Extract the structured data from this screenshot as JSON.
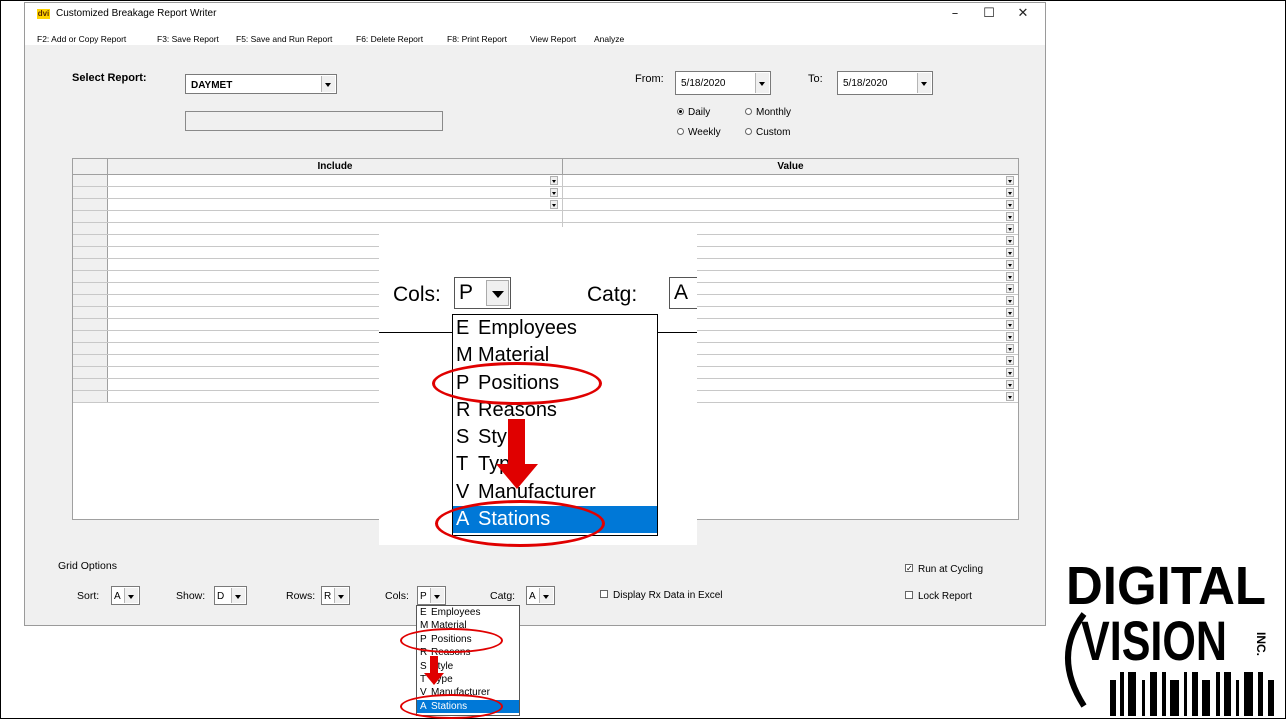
{
  "window": {
    "app_icon": "dvi",
    "title": "Customized Breakage Report Writer",
    "controls": [
      "–",
      "☐",
      "✕"
    ]
  },
  "menu": [
    "F2: Add or Copy Report",
    "F3: Save Report",
    "F5: Save and Run Report",
    "F6: Delete Report",
    "F8: Print Report",
    "View Report",
    "Analyze"
  ],
  "report": {
    "select_label": "Select Report:",
    "selected": "DAYMET",
    "description": ""
  },
  "dates": {
    "from_label": "From:",
    "from_value": "5/18/2020",
    "to_label": "To:",
    "to_value": "5/18/2020"
  },
  "period": {
    "options": [
      "Daily",
      "Monthly",
      "Weekly",
      "Custom"
    ],
    "selected": "Daily"
  },
  "grid": {
    "headers": [
      "Include",
      "Value"
    ],
    "row_count": 19
  },
  "grid_options": {
    "title": "Grid Options",
    "sort_label": "Sort:",
    "sort_value": "A",
    "show_label": "Show:",
    "show_value": "D",
    "rows_label": "Rows:",
    "rows_value": "R",
    "cols_label": "Cols:",
    "cols_value": "P",
    "catg_label": "Catg:",
    "catg_value": "A",
    "display_rx_label": "Display Rx Data in Excel",
    "display_rx_checked": false,
    "run_cycling_label": "Run at Cycling",
    "run_cycling_checked": true,
    "lock_report_label": "Lock Report",
    "lock_report_checked": false
  },
  "cols_dropdown": {
    "items": [
      {
        "key": "E",
        "label": "Employees"
      },
      {
        "key": "M",
        "label": "Material"
      },
      {
        "key": "P",
        "label": "Positions"
      },
      {
        "key": "R",
        "label": "Reasons"
      },
      {
        "key": "S",
        "label": "Style"
      },
      {
        "key": "T",
        "label": "Type"
      },
      {
        "key": "V",
        "label": "Manufacturer"
      },
      {
        "key": "A",
        "label": "Stations"
      }
    ],
    "highlighted": "A"
  },
  "callout": {
    "cols_label": "Cols:",
    "cols_value": "P",
    "catg_label": "Catg:",
    "catg_value": "A"
  },
  "logo": {
    "text": "DIGITAL VISION INC.",
    "colors": {
      "ink": "#000000"
    }
  },
  "colors": {
    "highlight": "#0078d7",
    "annotation_red": "#e00000",
    "window_bg": "#f0f0f0"
  }
}
